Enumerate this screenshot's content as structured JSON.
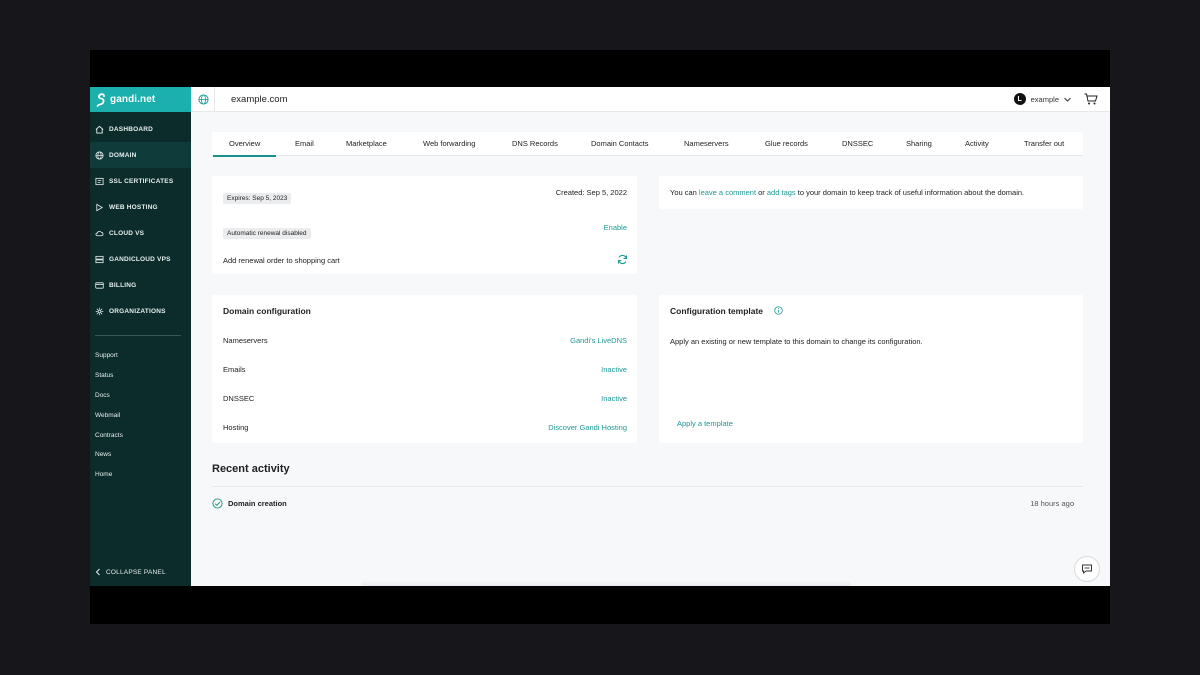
{
  "brand": {
    "logo_text": "gandi.net",
    "accent": "#1bb0ae",
    "sidebar_bg": "#0c2b2b",
    "link_color": "#1b9a96"
  },
  "sidebar": {
    "nav": [
      {
        "label": "DASHBOARD",
        "icon": "home-icon"
      },
      {
        "label": "DOMAIN",
        "icon": "globe-icon"
      },
      {
        "label": "SSL CERTIFICATES",
        "icon": "certificate-icon"
      },
      {
        "label": "WEB HOSTING",
        "icon": "hosting-icon"
      },
      {
        "label": "CLOUD VS",
        "icon": "cloud-icon"
      },
      {
        "label": "GANDICLOUD VPS",
        "icon": "vps-icon"
      },
      {
        "label": "BILLING",
        "icon": "card-icon"
      },
      {
        "label": "ORGANIZATIONS",
        "icon": "organizations-icon"
      }
    ],
    "active_index": 1,
    "links": [
      "Support",
      "Status",
      "Docs",
      "Webmail",
      "Contracts",
      "News",
      "Home"
    ],
    "collapse_label": "COLLAPSE PANEL"
  },
  "topbar": {
    "domain": "example.com",
    "avatar_initial": "L",
    "account": "example"
  },
  "tabs": [
    "Overview",
    "Email",
    "Marketplace",
    "Web forwarding",
    "DNS Records",
    "Domain Contacts",
    "Nameservers",
    "Glue records",
    "DNSSEC",
    "Sharing",
    "Activity",
    "Transfer out"
  ],
  "renewal": {
    "expires": "Expires: Sep 5, 2023",
    "created": "Created: Sep 5, 2022",
    "auto_renew_badge": "Automatic renewal disabled",
    "enable_label": "Enable",
    "cart_label": "Add renewal order to shopping cart"
  },
  "comment_card": {
    "prefix": "You can ",
    "comment_link": "leave a comment",
    "middle": " or ",
    "tags_link": "add tags",
    "suffix": " to your domain to keep track of useful information about the domain."
  },
  "config": {
    "title": "Domain configuration",
    "rows": [
      {
        "label": "Nameservers",
        "value": "Gandi's LiveDNS"
      },
      {
        "label": "Emails",
        "value": "Inactive"
      },
      {
        "label": "DNSSEC",
        "value": "Inactive"
      },
      {
        "label": "Hosting",
        "value": "Discover Gandi Hosting"
      }
    ]
  },
  "template": {
    "title": "Configuration template",
    "description": "Apply an existing or new template to this domain to change its configuration.",
    "apply_label": "Apply a template"
  },
  "recent": {
    "title": "Recent activity",
    "items": [
      {
        "name": "Domain creation",
        "time": "18 hours ago"
      }
    ]
  }
}
